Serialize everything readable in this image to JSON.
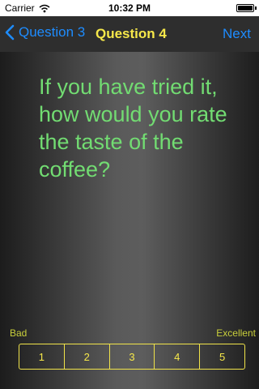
{
  "status_bar": {
    "carrier": "Carrier",
    "time": "10:32 PM"
  },
  "nav": {
    "back_label": "Question 3",
    "title": "Question 4",
    "next_label": "Next"
  },
  "question": {
    "text": "If you have tried it, how would you rate the taste of the coffee?"
  },
  "rating": {
    "low_label": "Bad",
    "high_label": "Excellent",
    "options": [
      "1",
      "2",
      "3",
      "4",
      "5"
    ]
  },
  "colors": {
    "accent_blue": "#1e8cff",
    "title_yellow": "#f6e84a",
    "question_green": "#72dc72",
    "scale_label_yellow": "#c9cf3b"
  },
  "icons": {
    "wifi": "wifi-icon",
    "battery": "battery-icon",
    "back": "chevron-left-icon"
  }
}
